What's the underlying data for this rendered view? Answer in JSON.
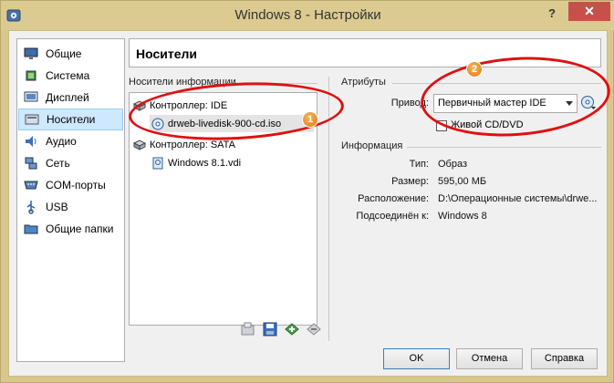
{
  "window": {
    "title": "Windows 8 - Настройки",
    "help": "?",
    "close": "✕"
  },
  "sidebar": {
    "items": [
      {
        "label": "Общие",
        "icon": "monitor-icon"
      },
      {
        "label": "Система",
        "icon": "chip-icon"
      },
      {
        "label": "Дисплей",
        "icon": "display-icon"
      },
      {
        "label": "Носители",
        "icon": "storage-icon",
        "selected": true
      },
      {
        "label": "Аудио",
        "icon": "speaker-icon"
      },
      {
        "label": "Сеть",
        "icon": "network-icon"
      },
      {
        "label": "COM-порты",
        "icon": "serial-port-icon"
      },
      {
        "label": "USB",
        "icon": "usb-icon"
      },
      {
        "label": "Общие папки",
        "icon": "folder-icon"
      }
    ]
  },
  "page_title": "Носители",
  "storage": {
    "group_label": "Носители информации",
    "tree": [
      {
        "label": "Контроллер: IDE",
        "kind": "controller"
      },
      {
        "label": "drweb-livedisk-900-cd.iso",
        "kind": "optical",
        "selected": true
      },
      {
        "label": "Контроллер: SATA",
        "kind": "controller"
      },
      {
        "label": "Windows 8.1.vdi",
        "kind": "hdd"
      }
    ]
  },
  "attributes": {
    "group_label": "Атрибуты",
    "drive_label": "Привод:",
    "drive_value": "Первичный мастер IDE",
    "live_cd_label": "Живой CD/DVD",
    "live_cd_checked": false
  },
  "info": {
    "group_label": "Информация",
    "rows": [
      {
        "label": "Тип:",
        "value": "Образ"
      },
      {
        "label": "Размер:",
        "value": "595,00 МБ"
      },
      {
        "label": "Расположение:",
        "value": "D:\\Операционные системы\\drwe..."
      },
      {
        "label": "Подсоединён к:",
        "value": "Windows 8"
      }
    ]
  },
  "callouts": {
    "one": "1",
    "two": "2"
  },
  "buttons": {
    "ok": "OK",
    "cancel": "Отмена",
    "help": "Справка"
  },
  "colors": {
    "titlebar": "#dccb90",
    "selection": "#cde8ff",
    "callout": "#e01010",
    "badge": "#e07b10"
  }
}
